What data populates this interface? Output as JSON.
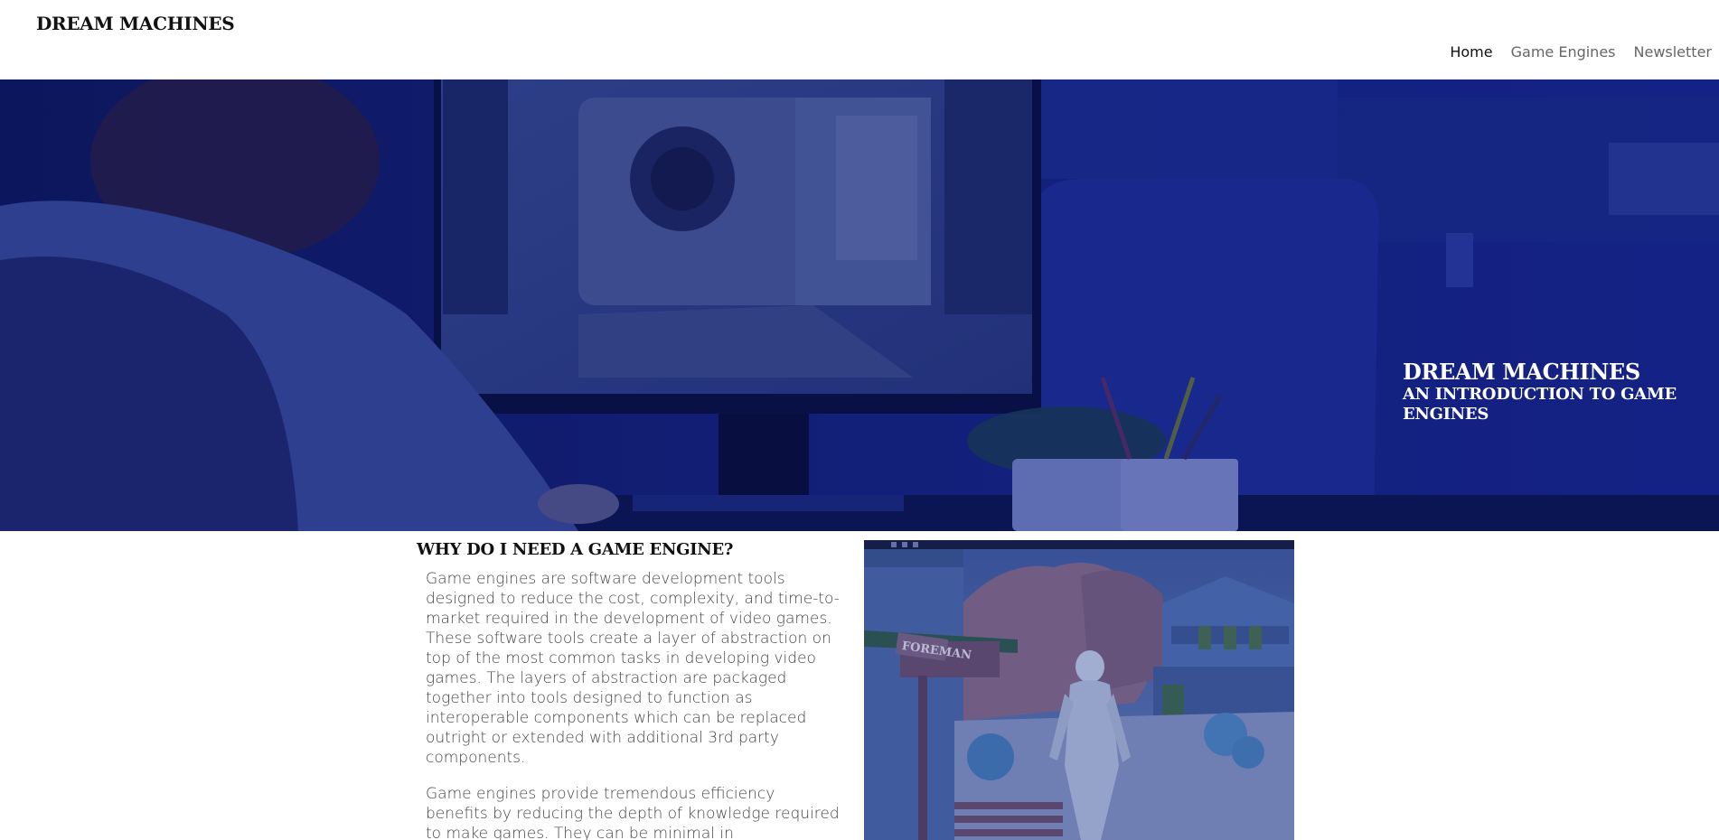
{
  "header": {
    "site_title": "DREAM MACHINES",
    "nav": [
      {
        "label": "Home",
        "active": true
      },
      {
        "label": "Game Engines",
        "active": false
      },
      {
        "label": "Newsletter",
        "active": false
      }
    ]
  },
  "hero": {
    "title": "DREAM MACHINES",
    "subtitle": "AN INTRODUCTION TO GAME ENGINES",
    "overlay_color": "#0f1c63"
  },
  "main": {
    "heading": "WHY DO I NEED A GAME ENGINE?",
    "paragraphs": [
      "Game engines are software development tools designed to reduce the cost, complexity, and time-to-market required in the development of video games. These software tools create a layer of abstraction on top of the most common tasks in developing video games. The layers of abstraction are packaged together into tools designed to function as interoperable components which can be replaced outright or extended with additional 3rd party components.",
      "Game engines provide tremendous efficiency benefits by reducing the depth of knowledge required to make games. They can be minimal in"
    ],
    "figure": {
      "sign_text": "FOREMAN"
    }
  }
}
